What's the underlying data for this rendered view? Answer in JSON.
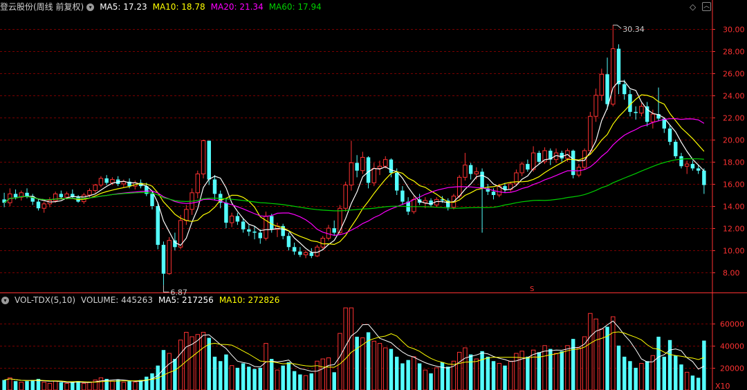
{
  "price_header": {
    "stock_title": "登云股份(周线 前复权)",
    "ma5": "MA5: 17.23",
    "ma10": "MA10: 18.78",
    "ma20": "MA20: 21.34",
    "ma60": "MA60: 17.94"
  },
  "volume_header": {
    "indicator": "VOL-TDX(5,10)",
    "volume": "VOLUME: 445263",
    "ma5": "MA5: 217256",
    "ma10": "MA10: 272826"
  },
  "price_axis": {
    "ticks": [
      "30.00",
      "28.00",
      "26.00",
      "24.00",
      "22.00",
      "20.00",
      "18.00",
      "16.00",
      "14.00",
      "12.00",
      "10.00",
      "8.00"
    ],
    "range": [
      6.2,
      31.6
    ]
  },
  "volume_axis": {
    "ticks": [
      "60000",
      "40000",
      "20000"
    ],
    "unit": "X10",
    "range": [
      0,
      76000
    ]
  },
  "annotations": {
    "high_label": "30.34",
    "low_label": "6.87",
    "marker": "S"
  },
  "colors": {
    "up": "#ff3232",
    "down": "#54ffff",
    "ma5": "#ffffff",
    "ma10": "#ffff00",
    "ma20": "#ff00ff",
    "ma60": "#00d000",
    "grid": "#7a0000",
    "axis_text": "#ff3232"
  },
  "icons": {
    "dropdown": "circle-chevron",
    "toolbar_left": "diamond",
    "toolbar_right": "up-chevron"
  },
  "chart_data": {
    "type": "candlestick",
    "ohlcv": [
      [
        14.6,
        15.2,
        13.9,
        14.3,
        9000
      ],
      [
        14.3,
        15.6,
        14.0,
        15.1,
        11000
      ],
      [
        15.1,
        15.5,
        14.6,
        14.8,
        8000
      ],
      [
        14.8,
        15.4,
        14.5,
        15.2,
        7000
      ],
      [
        15.2,
        15.6,
        14.7,
        14.9,
        8000
      ],
      [
        14.9,
        15.1,
        14.1,
        14.4,
        9000
      ],
      [
        14.4,
        14.7,
        13.6,
        13.8,
        10000
      ],
      [
        13.8,
        14.4,
        13.4,
        14.2,
        7000
      ],
      [
        14.2,
        14.8,
        13.9,
        14.5,
        6000
      ],
      [
        14.5,
        15.3,
        14.3,
        15.1,
        8000
      ],
      [
        15.1,
        15.4,
        14.6,
        14.8,
        7000
      ],
      [
        14.8,
        15.3,
        14.6,
        15.1,
        6000
      ],
      [
        15.1,
        15.5,
        14.7,
        14.8,
        7000
      ],
      [
        14.8,
        15.0,
        14.3,
        14.4,
        8000
      ],
      [
        14.4,
        15.2,
        14.2,
        15.0,
        6000
      ],
      [
        15.0,
        15.6,
        14.8,
        15.4,
        7000
      ],
      [
        15.4,
        16.0,
        15.2,
        15.9,
        9000
      ],
      [
        15.9,
        16.7,
        15.7,
        16.5,
        11000
      ],
      [
        16.5,
        16.8,
        15.9,
        16.1,
        10000
      ],
      [
        16.1,
        16.6,
        15.9,
        16.4,
        8000
      ],
      [
        16.4,
        16.7,
        15.8,
        16.0,
        9000
      ],
      [
        16.0,
        16.4,
        15.7,
        16.2,
        7000
      ],
      [
        16.2,
        16.5,
        15.6,
        15.8,
        8000
      ],
      [
        15.8,
        16.3,
        15.5,
        16.1,
        7000
      ],
      [
        16.1,
        16.4,
        15.6,
        15.8,
        9000
      ],
      [
        15.8,
        16.1,
        14.9,
        15.1,
        12000
      ],
      [
        15.1,
        15.4,
        13.7,
        14.0,
        15000
      ],
      [
        14.0,
        14.3,
        10.1,
        10.5,
        22000
      ],
      [
        10.5,
        10.8,
        6.87,
        7.9,
        36000
      ],
      [
        7.9,
        11.2,
        7.8,
        10.9,
        33000
      ],
      [
        10.9,
        11.6,
        10.0,
        10.3,
        28000
      ],
      [
        10.3,
        13.2,
        10.1,
        12.7,
        45000
      ],
      [
        12.7,
        14.1,
        12.3,
        13.7,
        52000
      ],
      [
        13.7,
        15.6,
        13.2,
        15.2,
        48000
      ],
      [
        15.2,
        17.2,
        14.7,
        16.9,
        50000
      ],
      [
        16.9,
        20.0,
        16.5,
        19.9,
        52000
      ],
      [
        19.9,
        19.9,
        15.9,
        16.4,
        47000
      ],
      [
        16.4,
        16.8,
        14.5,
        15.1,
        30000
      ],
      [
        15.1,
        15.4,
        13.8,
        14.3,
        26000
      ],
      [
        14.3,
        14.7,
        12.0,
        12.5,
        32000
      ],
      [
        12.5,
        13.4,
        12.1,
        13.1,
        22000
      ],
      [
        13.1,
        13.4,
        12.3,
        12.6,
        20000
      ],
      [
        12.6,
        12.9,
        11.6,
        11.9,
        24000
      ],
      [
        11.9,
        12.3,
        11.3,
        11.7,
        21000
      ],
      [
        11.7,
        12.2,
        11.0,
        11.6,
        19000
      ],
      [
        11.6,
        11.9,
        10.6,
        11.1,
        20000
      ],
      [
        11.1,
        13.5,
        10.9,
        13.1,
        42000
      ],
      [
        13.1,
        13.3,
        11.6,
        11.9,
        28000
      ],
      [
        11.9,
        12.5,
        11.2,
        12.2,
        18000
      ],
      [
        12.2,
        12.4,
        11.0,
        11.3,
        22000
      ],
      [
        11.3,
        11.6,
        10.0,
        10.3,
        25000
      ],
      [
        10.3,
        10.7,
        9.6,
        9.9,
        17000
      ],
      [
        9.9,
        10.3,
        9.4,
        9.6,
        14000
      ],
      [
        9.6,
        10.0,
        9.3,
        9.8,
        13000
      ],
      [
        9.8,
        10.2,
        9.3,
        9.5,
        15000
      ],
      [
        9.5,
        10.5,
        9.4,
        10.3,
        26000
      ],
      [
        10.3,
        11.3,
        10.1,
        11.1,
        28000
      ],
      [
        11.1,
        12.3,
        10.9,
        12.0,
        29000
      ],
      [
        12.0,
        12.7,
        11.3,
        11.6,
        16000
      ],
      [
        11.6,
        14.1,
        11.4,
        13.8,
        51000
      ],
      [
        13.8,
        16.2,
        13.5,
        15.9,
        74000
      ],
      [
        15.9,
        19.9,
        15.4,
        17.9,
        74000
      ],
      [
        17.9,
        18.6,
        16.6,
        17.2,
        48000
      ],
      [
        17.2,
        18.9,
        16.9,
        18.4,
        47000
      ],
      [
        18.4,
        18.5,
        15.6,
        16.1,
        52000
      ],
      [
        16.1,
        17.9,
        15.8,
        17.4,
        44000
      ],
      [
        17.4,
        18.1,
        16.8,
        17.6,
        42000
      ],
      [
        17.6,
        18.5,
        17.4,
        18.2,
        38000
      ],
      [
        18.2,
        18.3,
        16.6,
        17.0,
        37000
      ],
      [
        17.0,
        17.4,
        15.0,
        15.4,
        30000
      ],
      [
        15.4,
        15.8,
        14.1,
        14.4,
        24000
      ],
      [
        14.4,
        14.8,
        13.2,
        13.5,
        27000
      ],
      [
        13.5,
        14.9,
        13.3,
        14.6,
        30000
      ],
      [
        14.6,
        15.1,
        14.1,
        14.3,
        24000
      ],
      [
        14.3,
        14.8,
        13.8,
        14.5,
        18000
      ],
      [
        14.5,
        14.7,
        13.9,
        14.1,
        15000
      ],
      [
        14.1,
        14.8,
        13.9,
        14.6,
        20000
      ],
      [
        14.6,
        14.9,
        14.3,
        14.5,
        25000
      ],
      [
        14.5,
        14.7,
        13.6,
        13.9,
        21000
      ],
      [
        13.9,
        15.1,
        13.7,
        14.9,
        26000
      ],
      [
        14.9,
        16.8,
        14.7,
        16.6,
        34000
      ],
      [
        16.6,
        18.8,
        16.3,
        17.7,
        38000
      ],
      [
        17.7,
        17.9,
        16.4,
        16.9,
        32000
      ],
      [
        16.9,
        17.5,
        16.4,
        17.1,
        28000
      ],
      [
        17.1,
        17.4,
        11.6,
        15.6,
        35000
      ],
      [
        15.6,
        16.0,
        15.0,
        15.3,
        30000
      ],
      [
        15.3,
        15.6,
        14.6,
        15.0,
        26000
      ],
      [
        15.0,
        16.0,
        14.8,
        15.8,
        24000
      ],
      [
        15.8,
        16.1,
        15.2,
        15.5,
        22000
      ],
      [
        15.5,
        16.2,
        15.3,
        16.0,
        26000
      ],
      [
        16.0,
        17.3,
        15.8,
        17.0,
        33000
      ],
      [
        17.0,
        18.0,
        16.7,
        17.8,
        35000
      ],
      [
        17.8,
        18.2,
        17.1,
        17.3,
        30000
      ],
      [
        17.3,
        19.4,
        17.1,
        18.8,
        36000
      ],
      [
        18.8,
        19.0,
        17.8,
        18.0,
        34000
      ],
      [
        18.0,
        19.3,
        17.8,
        19.0,
        40000
      ],
      [
        19.0,
        19.2,
        17.7,
        18.2,
        37000
      ],
      [
        18.2,
        19.2,
        17.9,
        18.8,
        33000
      ],
      [
        18.8,
        19.0,
        18.0,
        18.3,
        35000
      ],
      [
        18.3,
        19.2,
        18.0,
        19.0,
        40000
      ],
      [
        19.0,
        19.1,
        16.5,
        16.8,
        46000
      ],
      [
        16.8,
        17.8,
        16.6,
        17.5,
        38000
      ],
      [
        17.5,
        19.2,
        17.3,
        19.0,
        48000
      ],
      [
        19.0,
        22.5,
        18.7,
        22.1,
        69000
      ],
      [
        22.1,
        24.6,
        21.6,
        24.0,
        64000
      ],
      [
        24.0,
        26.4,
        23.5,
        25.9,
        55000
      ],
      [
        25.9,
        27.4,
        22.7,
        23.2,
        57000
      ],
      [
        23.2,
        30.34,
        23.0,
        28.2,
        66000
      ],
      [
        28.2,
        28.6,
        24.1,
        25.0,
        40000
      ],
      [
        25.0,
        25.4,
        23.6,
        24.1,
        30000
      ],
      [
        24.1,
        24.5,
        22.1,
        22.5,
        26000
      ],
      [
        22.5,
        23.0,
        21.8,
        22.4,
        20000
      ],
      [
        22.4,
        23.3,
        22.1,
        23.0,
        24000
      ],
      [
        23.0,
        23.4,
        21.2,
        21.6,
        26000
      ],
      [
        21.6,
        22.7,
        21.0,
        22.3,
        31000
      ],
      [
        22.3,
        24.7,
        21.7,
        21.9,
        48000
      ],
      [
        21.9,
        22.0,
        20.6,
        21.0,
        30000
      ],
      [
        21.0,
        21.3,
        19.5,
        19.8,
        45000
      ],
      [
        19.8,
        20.0,
        18.3,
        18.5,
        31000
      ],
      [
        18.5,
        18.8,
        17.4,
        17.6,
        23000
      ],
      [
        17.6,
        18.1,
        16.9,
        17.8,
        16000
      ],
      [
        17.8,
        18.1,
        17.2,
        17.4,
        13000
      ],
      [
        17.4,
        17.7,
        16.9,
        17.2,
        11000
      ],
      [
        17.2,
        17.4,
        15.1,
        15.9,
        44500
      ]
    ]
  }
}
